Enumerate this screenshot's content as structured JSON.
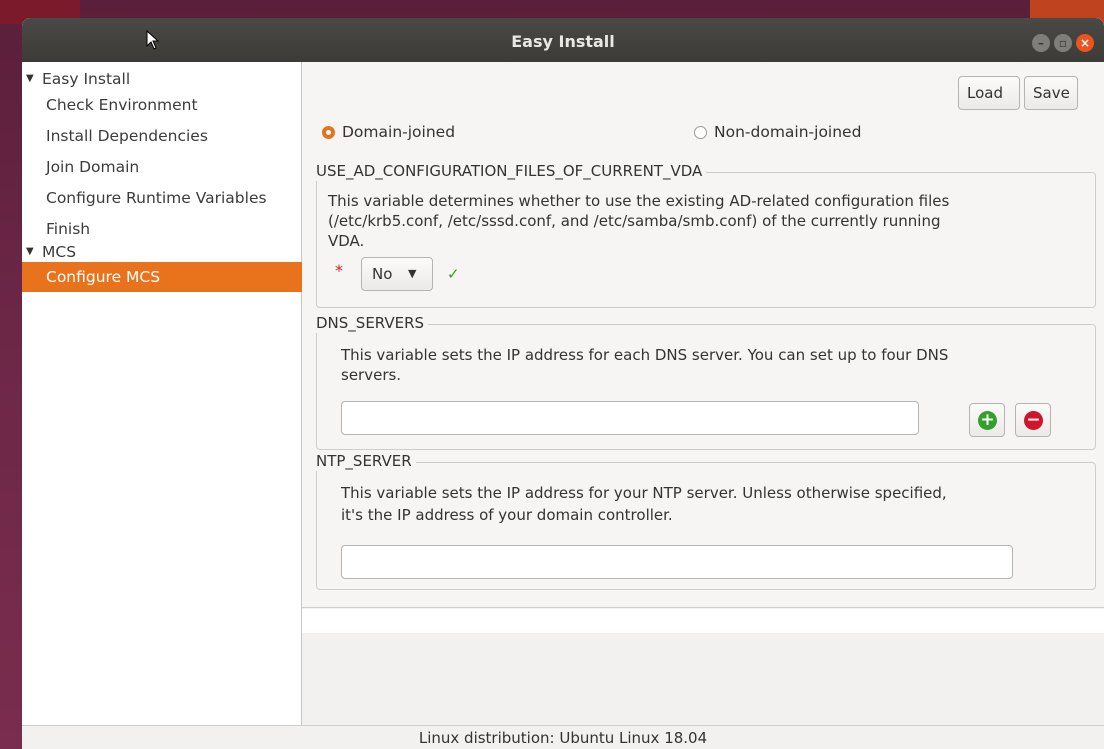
{
  "window": {
    "title": "Easy Install"
  },
  "sidebar": {
    "groups": [
      {
        "label": "Easy Install",
        "items": [
          {
            "label": "Check Environment"
          },
          {
            "label": "Install Dependencies"
          },
          {
            "label": "Join Domain"
          },
          {
            "label": "Configure Runtime Variables"
          },
          {
            "label": "Finish"
          }
        ]
      },
      {
        "label": "MCS",
        "items": [
          {
            "label": "Configure MCS",
            "selected": true
          }
        ]
      }
    ]
  },
  "toolbar": {
    "load_label": "Load",
    "save_label": "Save"
  },
  "join_mode": {
    "options": [
      {
        "label": "Domain-joined",
        "selected": true
      },
      {
        "label": "Non-domain-joined",
        "selected": false
      }
    ]
  },
  "sections": {
    "use_ad_config": {
      "title": "USE_AD_CONFIGURATION_FILES_OF_CURRENT_VDA",
      "description_line1": "This variable determines whether to use the existing AD-related configuration files",
      "description_line2": "(/etc/krb5.conf, /etc/sssd.conf, and /etc/samba/smb.conf) of the currently running",
      "description_line3": "VDA.",
      "required_marker": "*",
      "selected_value": "No",
      "valid_marker": "✓"
    },
    "dns_servers": {
      "title": "DNS_SERVERS",
      "description_line1": "This variable sets the IP address for each DNS server. You can set up to four DNS",
      "description_line2": "servers.",
      "input_value": "",
      "add_symbol": "+",
      "remove_symbol": "−"
    },
    "ntp_server": {
      "title": "NTP_SERVER",
      "description_line1": "This variable sets the IP address for your NTP server. Unless otherwise specified,",
      "description_line2": "it's the IP address of your domain controller.",
      "input_value": ""
    }
  },
  "status": {
    "text": "Linux distribution: Ubuntu Linux 18.04"
  },
  "icons": {
    "window_controls": [
      "minimize-icon",
      "maximize-icon",
      "close-icon"
    ],
    "tree_expander": "triangle-down-icon",
    "accent": "#e9721d"
  }
}
